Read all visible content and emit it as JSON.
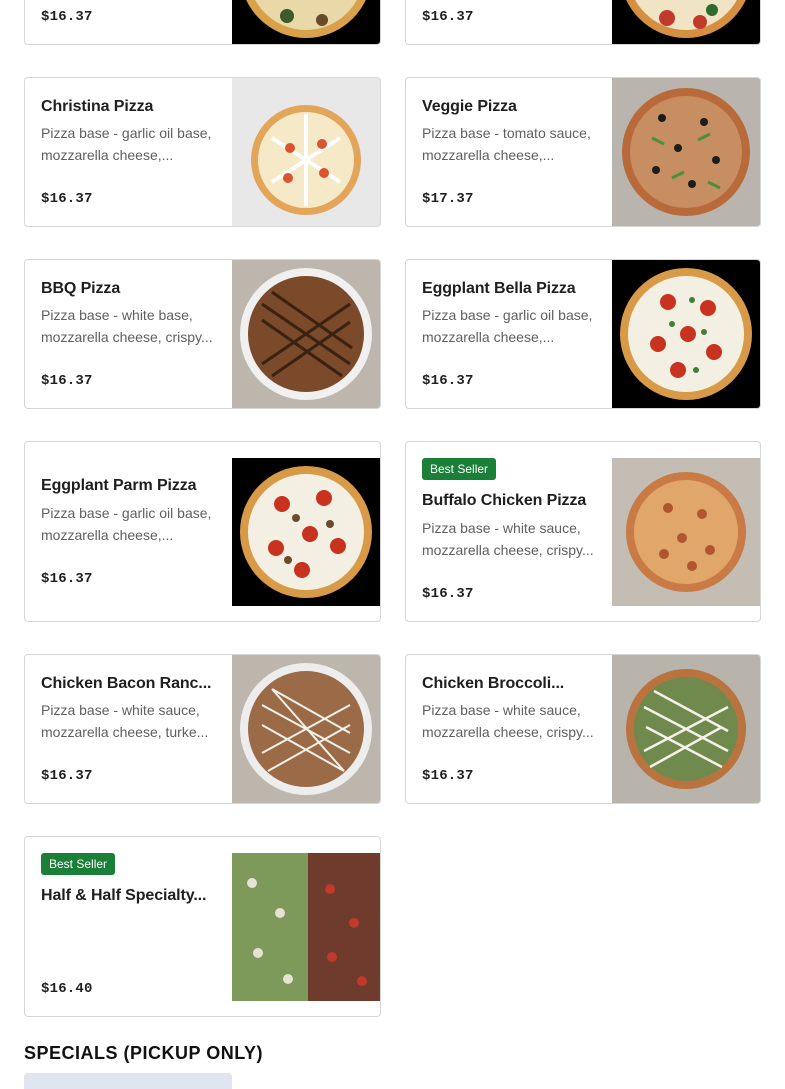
{
  "cards": [
    {
      "name": "",
      "desc1": "",
      "desc2": "",
      "price": "$16.37"
    },
    {
      "name": "",
      "desc1": "",
      "desc2": "",
      "price": "$16.37"
    },
    {
      "name": "Christina Pizza",
      "desc1": "Pizza base - garlic oil base,",
      "desc2": "mozzarella cheese,...",
      "price": "$16.37"
    },
    {
      "name": "Veggie Pizza",
      "desc1": "Pizza base - tomato sauce,",
      "desc2": "mozzarella cheese,...",
      "price": "$17.37"
    },
    {
      "name": "BBQ Pizza",
      "desc1": "Pizza base - white base,",
      "desc2": "mozzarella cheese, crispy...",
      "price": "$16.37"
    },
    {
      "name": "Eggplant Bella Pizza",
      "desc1": "Pizza base - garlic oil base,",
      "desc2": "mozzarella cheese,...",
      "price": "$16.37"
    },
    {
      "name": "Eggplant Parm Pizza",
      "desc1": "Pizza base - garlic oil base,",
      "desc2": "mozzarella cheese,...",
      "price": "$16.37"
    },
    {
      "badge": "Best Seller",
      "name": "Buffalo Chicken Pizza",
      "desc1": "Pizza base - white sauce,",
      "desc2": "mozzarella cheese, crispy...",
      "price": "$16.37"
    },
    {
      "name": "Chicken Bacon Ranc...",
      "desc1": "Pizza base - white sauce,",
      "desc2": "mozzarella cheese, turke...",
      "price": "$16.37"
    },
    {
      "name": "Chicken Broccoli...",
      "desc1": "Pizza base - white sauce,",
      "desc2": "mozzarella cheese, crispy...",
      "price": "$16.37"
    },
    {
      "badge": "Best Seller",
      "name": "Half & Half Specialty...",
      "price": "$16.40"
    }
  ],
  "section": {
    "title": "SPECIALS (PICKUP ONLY)"
  },
  "colors": {
    "badge": "#1a7f37",
    "border": "#d6d6d6",
    "text": "#1f1f1f",
    "muted": "#5f5f5f"
  }
}
